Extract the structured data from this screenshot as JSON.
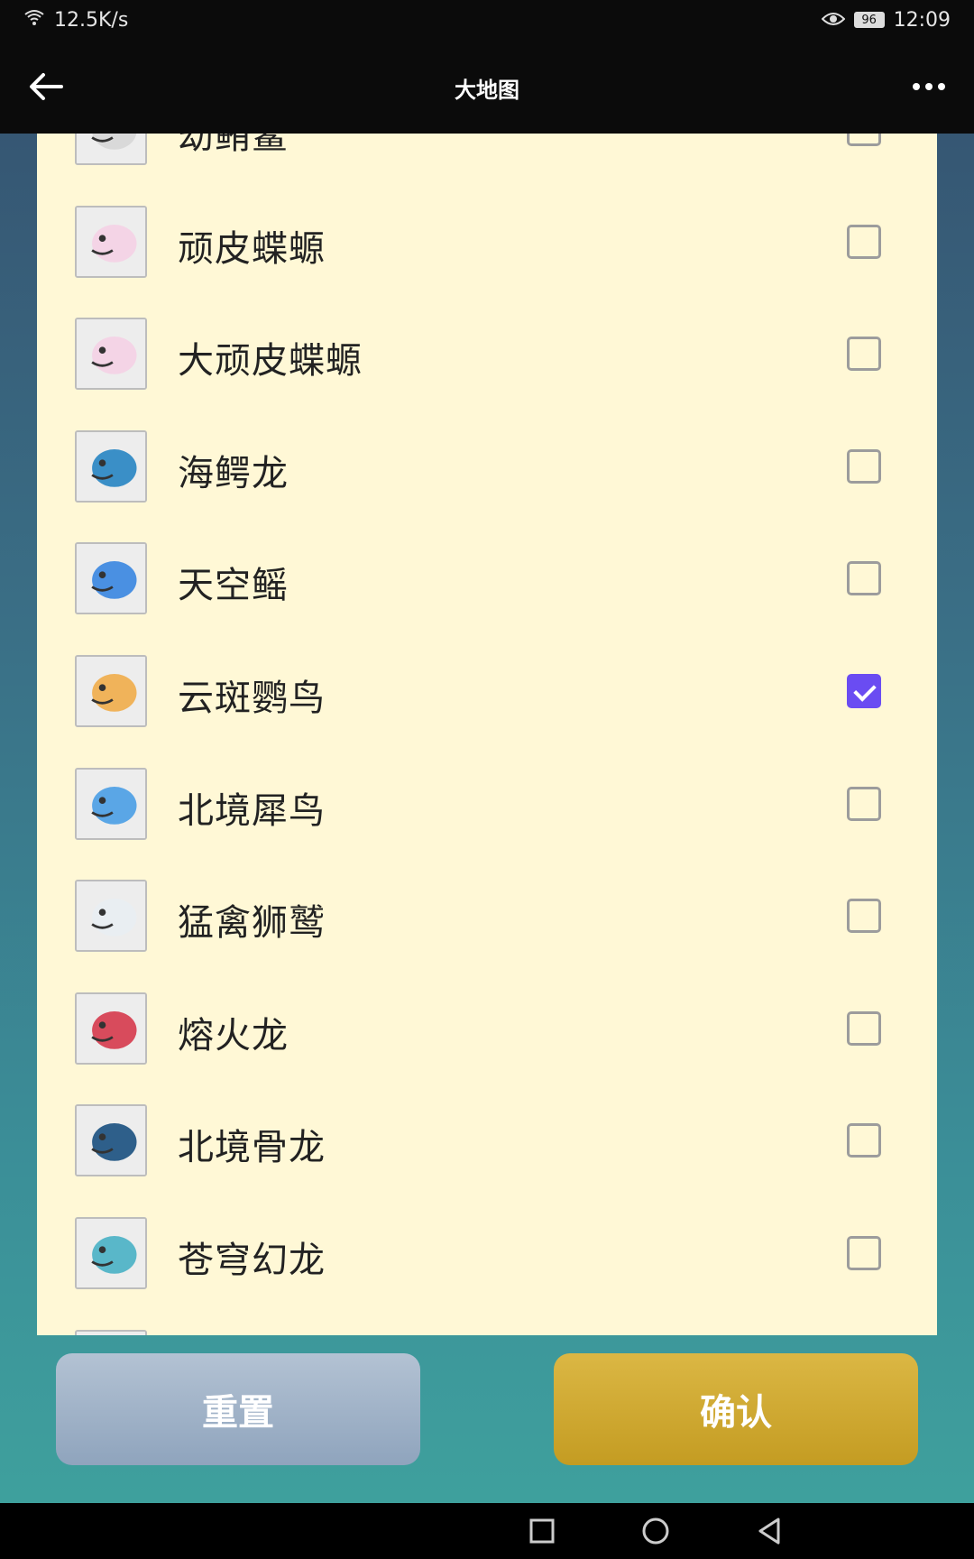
{
  "status_bar": {
    "speed": "12.5K/s",
    "battery": "96",
    "time": "12:09"
  },
  "header": {
    "title": "大地图"
  },
  "list": {
    "items": [
      {
        "name": "幼鲔鲨",
        "checked": false
      },
      {
        "name": "顽皮蝶螈",
        "checked": false
      },
      {
        "name": "大顽皮蝶螈",
        "checked": false
      },
      {
        "name": "海鳄龙",
        "checked": false
      },
      {
        "name": "天空鳐",
        "checked": false
      },
      {
        "name": "云斑鹦鸟",
        "checked": true
      },
      {
        "name": "北境犀鸟",
        "checked": false
      },
      {
        "name": "猛禽狮鹫",
        "checked": false
      },
      {
        "name": "熔火龙",
        "checked": false
      },
      {
        "name": "北境骨龙",
        "checked": false
      },
      {
        "name": "苍穹幻龙",
        "checked": false
      },
      {
        "name": "",
        "checked": false
      }
    ]
  },
  "footer": {
    "reset_label": "重置",
    "confirm_label": "确认"
  },
  "colors": {
    "accent": "#6a4cf2",
    "panel": "#fff8d6",
    "confirm": "#c9a230",
    "reset": "#9fb2c8"
  }
}
